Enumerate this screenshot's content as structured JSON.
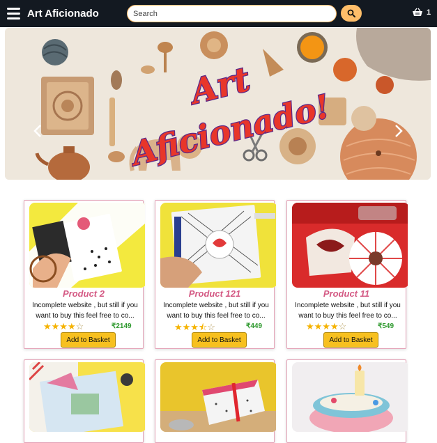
{
  "navbar": {
    "brand": "Art Aficionado",
    "search_placeholder": "Search",
    "search_value": "",
    "cart_count": "1",
    "colors": {
      "bar": "#131921",
      "accent": "#febd69"
    }
  },
  "banner": {
    "title_line1": "Art",
    "title_line2": "Aficionado!"
  },
  "products": [
    {
      "title": "Product 2",
      "desc": "Incomplete website , but still if you want to buy this feel free to co...",
      "rating": 4,
      "price": "₹2149",
      "button": "Add to Basket"
    },
    {
      "title": "Product 121",
      "desc": "Incomplete website , but still if you want to buy this feel free to co...",
      "rating": 3.5,
      "price": "₹449",
      "button": "Add to Basket"
    },
    {
      "title": "Product 11",
      "desc": "Incomplete website , but still if you want to buy this feel free to co...",
      "rating": 4,
      "price": "₹549",
      "button": "Add to Basket"
    }
  ],
  "icons": {
    "menu": "hamburger-icon",
    "search": "search-icon",
    "cart": "basket-icon",
    "prev": "chevron-left-icon",
    "next": "chevron-right-icon"
  }
}
